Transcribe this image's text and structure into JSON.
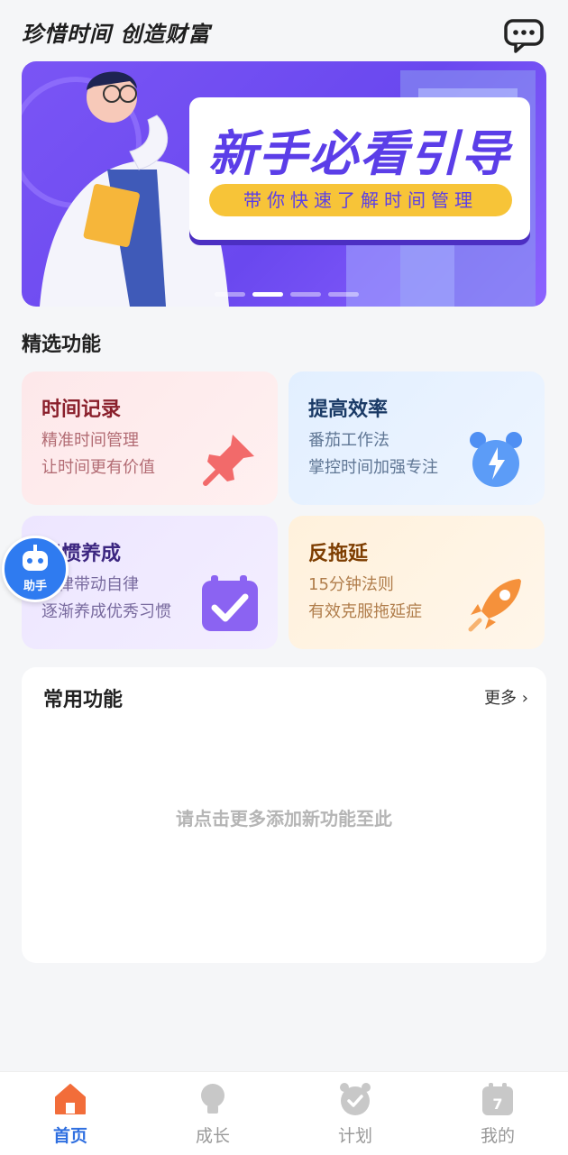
{
  "header": {
    "slogan": "珍惜时间  创造财富",
    "message_icon": "chat-bubble-icon"
  },
  "banner": {
    "title": "新手必看引导",
    "subtitle": "带你快速了解时间管理",
    "dots": 4,
    "active_dot": 1
  },
  "featured": {
    "title": "精选功能",
    "cards": [
      {
        "title": "时间记录",
        "line1": "精准时间管理",
        "line2": "让时间更有价值",
        "icon": "pin-icon"
      },
      {
        "title": "提高效率",
        "line1": "番茄工作法",
        "line2": "掌控时间加强专注",
        "icon": "alarm-clock-icon"
      },
      {
        "title": "习惯养成",
        "line1": "自律带动自律",
        "line2": "逐渐养成优秀习惯",
        "icon": "calendar-check-icon"
      },
      {
        "title": "反拖延",
        "line1": "15分钟法则",
        "line2": "有效克服拖延症",
        "icon": "rocket-icon"
      }
    ]
  },
  "assistant": {
    "label": "助手",
    "icon": "robot-icon"
  },
  "common": {
    "title": "常用功能",
    "more": "更多",
    "empty_hint": "请点击更多添加新功能至此"
  },
  "tabbar": {
    "items": [
      {
        "label": "首页",
        "icon": "home-icon",
        "active": true
      },
      {
        "label": "成长",
        "icon": "lightbulb-icon",
        "active": false
      },
      {
        "label": "计划",
        "icon": "clock-check-icon",
        "active": false
      },
      {
        "label": "我的",
        "icon": "calendar-icon",
        "active": false
      }
    ]
  },
  "colors": {
    "accent": "#2f6fe0",
    "banner": "#6a48ef",
    "banner_sub_bg": "#f7c438"
  }
}
